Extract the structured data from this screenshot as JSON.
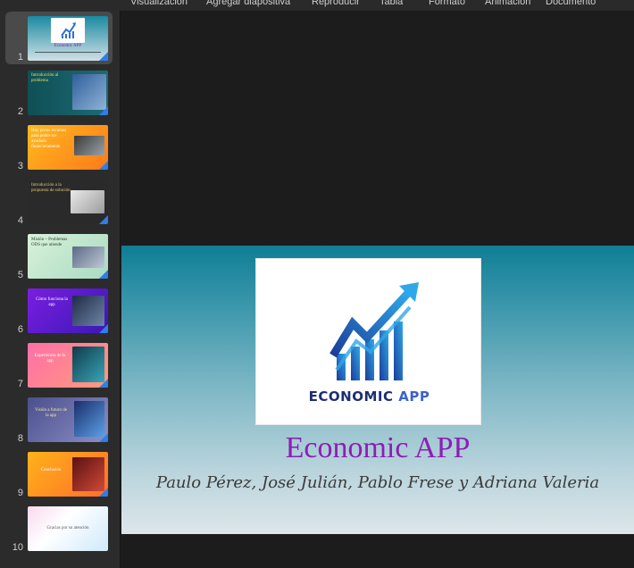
{
  "menu": {
    "items": [
      "Visualización",
      "Agregar diapositiva",
      "Reproducir",
      "Tabla",
      "Formato",
      "Animación",
      "Documento"
    ]
  },
  "slides": [
    {
      "number": "1",
      "title": "Economic APP",
      "selected": true
    },
    {
      "number": "2",
      "title": "Introducción al problema"
    },
    {
      "number": "3",
      "title": "Hay pocos recursos para poder ser ayudado financieramente"
    },
    {
      "number": "4",
      "title": "Introducción a la propuesta de solución"
    },
    {
      "number": "5",
      "title": "Misión – Problemas ODS que atiende"
    },
    {
      "number": "6",
      "title": "Cómo funciona la app"
    },
    {
      "number": "7",
      "title": "Experiencia de la app"
    },
    {
      "number": "8",
      "title": "Visión a futuro de la app"
    },
    {
      "number": "9",
      "title": "Conclusión"
    },
    {
      "number": "10",
      "title": "Gracias por su atención"
    }
  ],
  "current_slide": {
    "logo": {
      "word1": "ECONOMIC",
      "word2": "APP"
    },
    "title": "Economic APP",
    "subtitle": "Paulo Pérez, José Julián, Pablo Frese y Adriana Valeria"
  },
  "colors": {
    "accent": "#2f7ee8",
    "title": "#8e1db5",
    "logo_navy": "#1c2e72",
    "logo_blue": "#3b63c9"
  }
}
